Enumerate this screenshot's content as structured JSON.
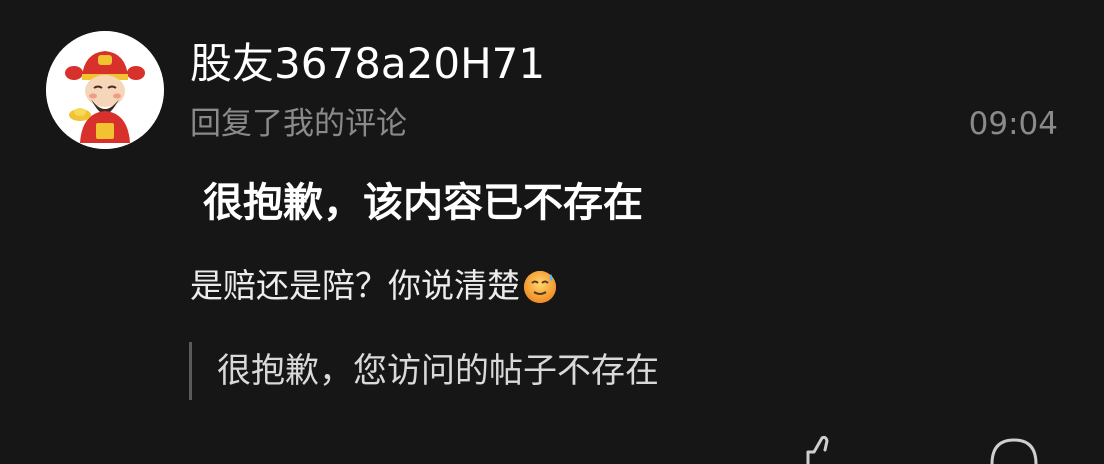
{
  "comment": {
    "avatar_icon": "caishen-avatar-icon",
    "username": "股友3678a20H71",
    "subtitle": "回复了我的评论",
    "time": "09:04",
    "deleted_notice": "很抱歉，该内容已不存在",
    "reply_text": "是赔还是陪？你说清楚",
    "reply_emoji": "sweat-smile-emoji",
    "quoted_text": "很抱歉，您访问的帖子不存在"
  },
  "actions": {
    "like_icon": "thumbs-up-icon",
    "comment_icon": "comment-bubble-icon"
  },
  "colors": {
    "background": "#161616",
    "primary_text": "#ffffff",
    "secondary_text": "#8a8a8a",
    "quote_bar": "#5a5a5a"
  }
}
